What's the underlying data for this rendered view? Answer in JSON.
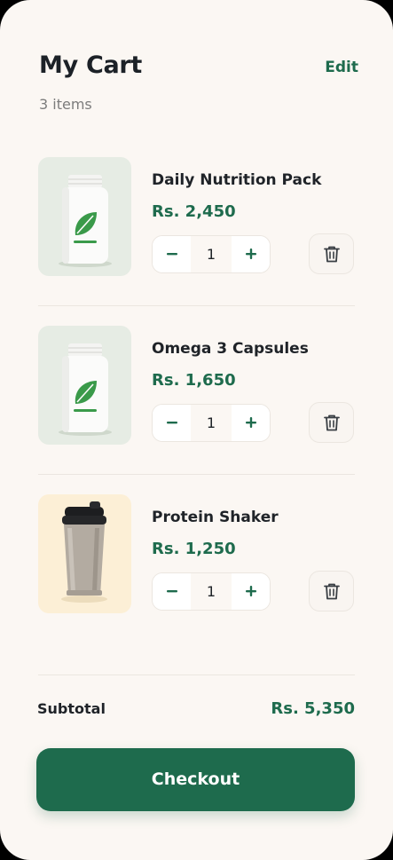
{
  "header": {
    "title": "My Cart",
    "edit_label": "Edit",
    "item_count": "3 items"
  },
  "items": [
    {
      "name": "Daily Nutrition Pack",
      "price": "Rs. 2,450",
      "quantity": "1",
      "image": "supplement-bottle-leaf-icon",
      "thumb_bg": "#e6ece4"
    },
    {
      "name": "Omega 3 Capsules",
      "price": "Rs. 1,650",
      "quantity": "1",
      "image": "supplement-bottle-leaf-icon",
      "thumb_bg": "#e6ece4"
    },
    {
      "name": "Protein Shaker",
      "price": "Rs. 1,250",
      "quantity": "1",
      "image": "shaker-bottle-icon",
      "thumb_bg": "#fcefd6"
    }
  ],
  "summary": {
    "subtotal_label": "Subtotal",
    "subtotal_value": "Rs. 5,350"
  },
  "checkout_label": "Checkout",
  "colors": {
    "accent": "#1e6b4d",
    "background": "#fbf7f3",
    "text": "#1f2328",
    "muted": "#7c7c7c"
  }
}
